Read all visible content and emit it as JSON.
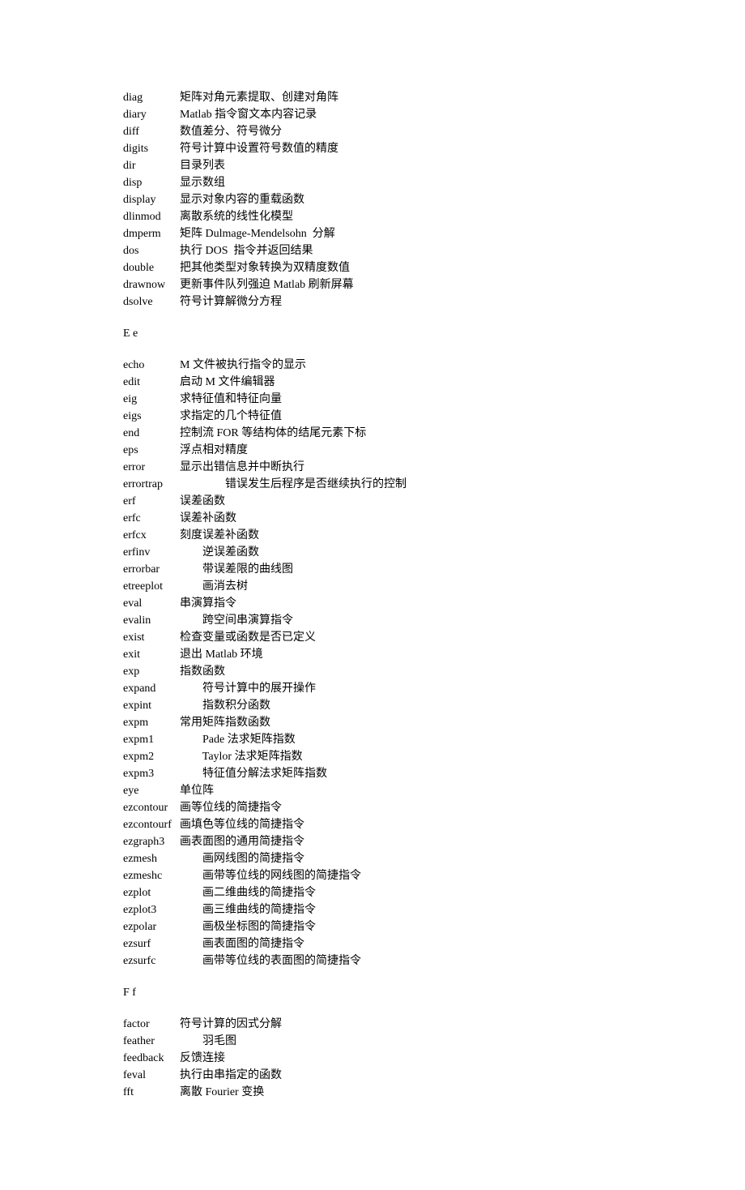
{
  "sections": [
    {
      "header": null,
      "entries": [
        {
          "cmd": "diag",
          "desc": "矩阵对角元素提取、创建对角阵"
        },
        {
          "cmd": "diary",
          "desc": "Matlab 指令窗文本内容记录"
        },
        {
          "cmd": "diff",
          "desc": "数值差分、符号微分"
        },
        {
          "cmd": "digits",
          "desc": "符号计算中设置符号数值的精度"
        },
        {
          "cmd": "dir",
          "desc": "目录列表"
        },
        {
          "cmd": "disp",
          "desc": "显示数组"
        },
        {
          "cmd": "display",
          "desc": "显示对象内容的重载函数"
        },
        {
          "cmd": "dlinmod",
          "desc": "离散系统的线性化模型"
        },
        {
          "cmd": "dmperm",
          "desc": "矩阵 Dulmage-Mendelsohn  分解"
        },
        {
          "cmd": "dos",
          "desc": "执行 DOS  指令并返回结果"
        },
        {
          "cmd": "double",
          "desc": "把其他类型对象转换为双精度数值"
        },
        {
          "cmd": "drawnow",
          "desc": "更新事件队列强迫 Matlab 刷新屏幕"
        },
        {
          "cmd": "dsolve",
          "desc": "符号计算解微分方程"
        }
      ]
    },
    {
      "header": "E e",
      "entries": [
        {
          "cmd": "echo",
          "desc": "M 文件被执行指令的显示"
        },
        {
          "cmd": "edit",
          "desc": "启动 M 文件编辑器"
        },
        {
          "cmd": "eig",
          "desc": "求特征值和特征向量"
        },
        {
          "cmd": "eigs",
          "desc": "求指定的几个特征值"
        },
        {
          "cmd": "end",
          "desc": "控制流 FOR 等结构体的结尾元素下标"
        },
        {
          "cmd": "eps",
          "desc": "浮点相对精度"
        },
        {
          "cmd": "error",
          "desc": "显示出错信息并中断执行"
        },
        {
          "cmd": "errortrap",
          "desc": "                错误发生后程序是否继续执行的控制"
        },
        {
          "cmd": "erf",
          "desc": "误差函数"
        },
        {
          "cmd": "erfc",
          "desc": "误差补函数"
        },
        {
          "cmd": "erfcx",
          "desc": "刻度误差补函数"
        },
        {
          "cmd": "erfinv",
          "desc": "        逆误差函数"
        },
        {
          "cmd": "errorbar",
          "desc": "        带误差限的曲线图"
        },
        {
          "cmd": "etreeplot",
          "desc": "        画消去树"
        },
        {
          "cmd": "eval",
          "desc": "串演算指令"
        },
        {
          "cmd": "evalin",
          "desc": "        跨空间串演算指令"
        },
        {
          "cmd": "exist",
          "desc": "检查变量或函数是否已定义"
        },
        {
          "cmd": "exit",
          "desc": "退出 Matlab 环境"
        },
        {
          "cmd": "exp",
          "desc": "指数函数"
        },
        {
          "cmd": "expand",
          "desc": "        符号计算中的展开操作"
        },
        {
          "cmd": "expint",
          "desc": "        指数积分函数"
        },
        {
          "cmd": "expm",
          "desc": "常用矩阵指数函数"
        },
        {
          "cmd": "expm1",
          "desc": "        Pade 法求矩阵指数"
        },
        {
          "cmd": "expm2",
          "desc": "        Taylor 法求矩阵指数"
        },
        {
          "cmd": "expm3",
          "desc": "        特征值分解法求矩阵指数"
        },
        {
          "cmd": "eye",
          "desc": "单位阵"
        },
        {
          "cmd": "ezcontour",
          "desc": "画等位线的简捷指令"
        },
        {
          "cmd": "ezcontourf",
          "desc": "画填色等位线的简捷指令"
        },
        {
          "cmd": "ezgraph3",
          "desc": "画表面图的通用简捷指令"
        },
        {
          "cmd": "ezmesh",
          "desc": "        画网线图的简捷指令"
        },
        {
          "cmd": "ezmeshc",
          "desc": "        画带等位线的网线图的简捷指令"
        },
        {
          "cmd": "ezplot",
          "desc": "        画二维曲线的简捷指令"
        },
        {
          "cmd": "ezplot3",
          "desc": "        画三维曲线的简捷指令"
        },
        {
          "cmd": "ezpolar",
          "desc": "        画极坐标图的简捷指令"
        },
        {
          "cmd": "ezsurf",
          "desc": "        画表面图的简捷指令"
        },
        {
          "cmd": "ezsurfc",
          "desc": "        画带等位线的表面图的简捷指令"
        }
      ]
    },
    {
      "header": "F f",
      "entries": [
        {
          "cmd": "factor",
          "desc": "符号计算的因式分解"
        },
        {
          "cmd": "feather",
          "desc": "        羽毛图"
        },
        {
          "cmd": "feedback",
          "desc": "反馈连接"
        },
        {
          "cmd": "feval",
          "desc": "执行由串指定的函数"
        },
        {
          "cmd": "fft",
          "desc": "离散 Fourier 变换"
        }
      ]
    }
  ]
}
